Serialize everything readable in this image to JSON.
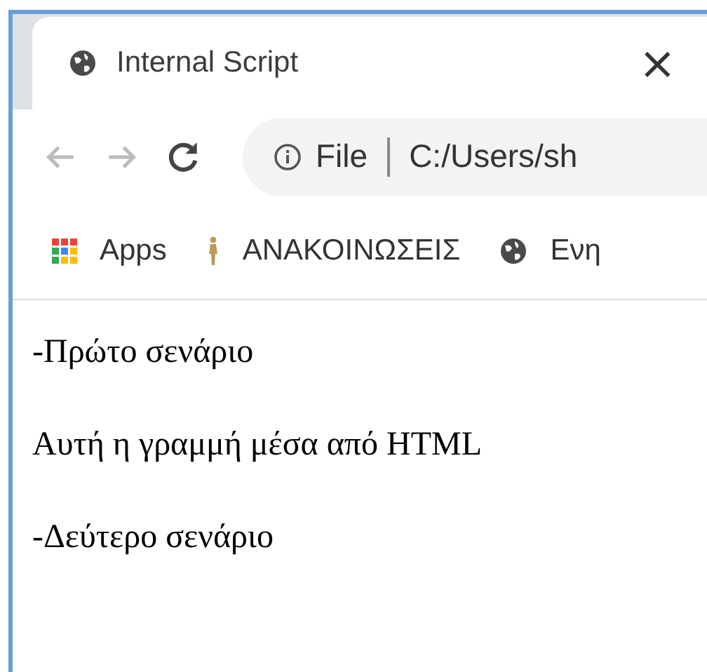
{
  "tab": {
    "title": "Internal Script",
    "close": "×"
  },
  "address_bar": {
    "scheme": "File",
    "url": "C:/Users/sh"
  },
  "bookmarks": [
    {
      "kind": "apps",
      "label": "Apps"
    },
    {
      "kind": "figure",
      "label": "ΑΝΑΚΟΙΝΩΣΕΙΣ"
    },
    {
      "kind": "globe",
      "label": "Ενη"
    }
  ],
  "content": [
    "-Πρώτο σενάριο",
    "Αυτή η γραμμή μέσα από HTML",
    "-Δεύτερο σενάριο"
  ]
}
